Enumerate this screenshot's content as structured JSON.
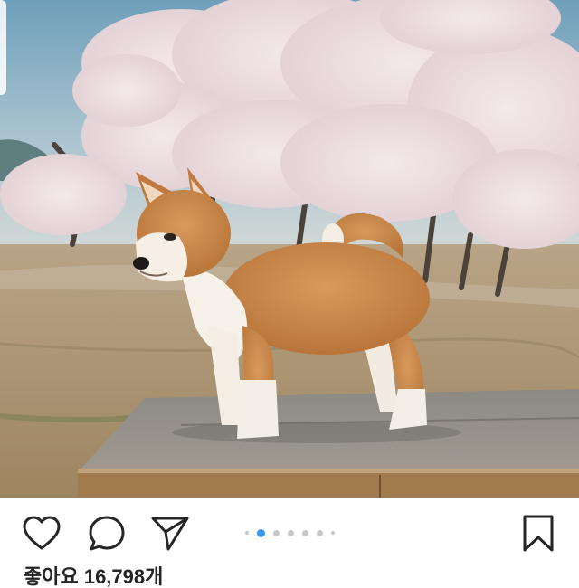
{
  "post": {
    "image_description_icon": "photo",
    "likes_label": "좋아요 16,798개"
  },
  "actions": {
    "like_icon": "heart-icon",
    "comment_icon": "comment-icon",
    "share_icon": "send-icon",
    "save_icon": "bookmark-icon"
  },
  "carousel": {
    "total": 6,
    "active_index": 1
  },
  "colors": {
    "accent": "#3897f0",
    "text": "#262626"
  }
}
